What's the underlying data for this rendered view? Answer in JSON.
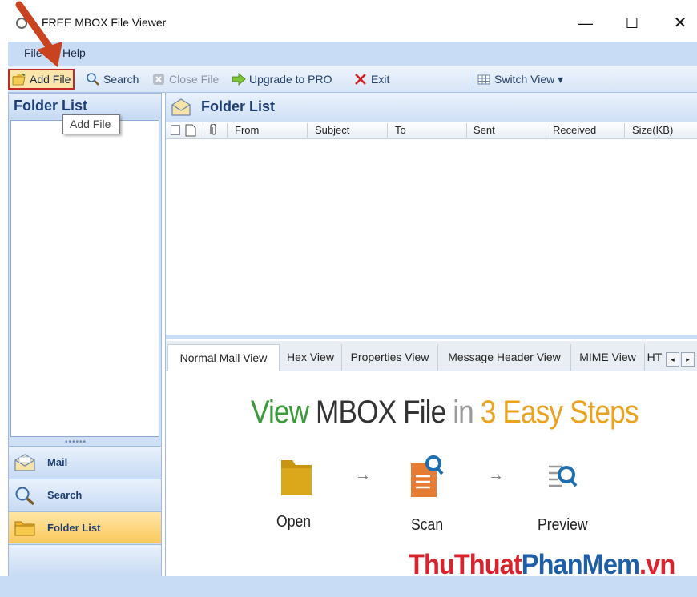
{
  "window": {
    "title": "FREE MBOX File Viewer",
    "minimize": "—",
    "maximize": "☐",
    "close": "✕"
  },
  "menu": {
    "file": "File",
    "help": "Help"
  },
  "toolbar": {
    "add_file": "Add File",
    "search": "Search",
    "close_file": "Close File",
    "upgrade": "Upgrade to PRO",
    "exit": "Exit",
    "switch_view": "Switch View ▾"
  },
  "tooltip": "Add File",
  "left_pane": {
    "title": "Folder List",
    "grip": "••••••",
    "nav": [
      {
        "label": "Mail",
        "icon": "mail-icon"
      },
      {
        "label": "Search",
        "icon": "search-icon"
      },
      {
        "label": "Folder List",
        "icon": "folder-icon"
      }
    ]
  },
  "right_pane": {
    "title": "Folder List",
    "columns": [
      "From",
      "Subject",
      "To",
      "Sent",
      "Received",
      "Size(KB)"
    ],
    "tabs": [
      "Normal Mail View",
      "Hex View",
      "Properties View",
      "Message Header View",
      "MIME View",
      "HT"
    ],
    "tab_arrows": [
      "◂",
      "▸"
    ]
  },
  "preview": {
    "headline": {
      "part1": "View",
      "part2": " MBOX File",
      "part3": " in",
      "part4": " 3 Easy Steps"
    },
    "arrow": "→",
    "steps": [
      "Open",
      "Scan",
      "Preview"
    ]
  },
  "watermark": {
    "part1": "ThuThuat",
    "part2": "PhanMem",
    "part3": ".vn"
  },
  "colors": {
    "accent_blue": "#1e3f75",
    "highlight_red": "#c62828",
    "headline_green": "#3a9b3a",
    "headline_orange": "#e9a321"
  }
}
